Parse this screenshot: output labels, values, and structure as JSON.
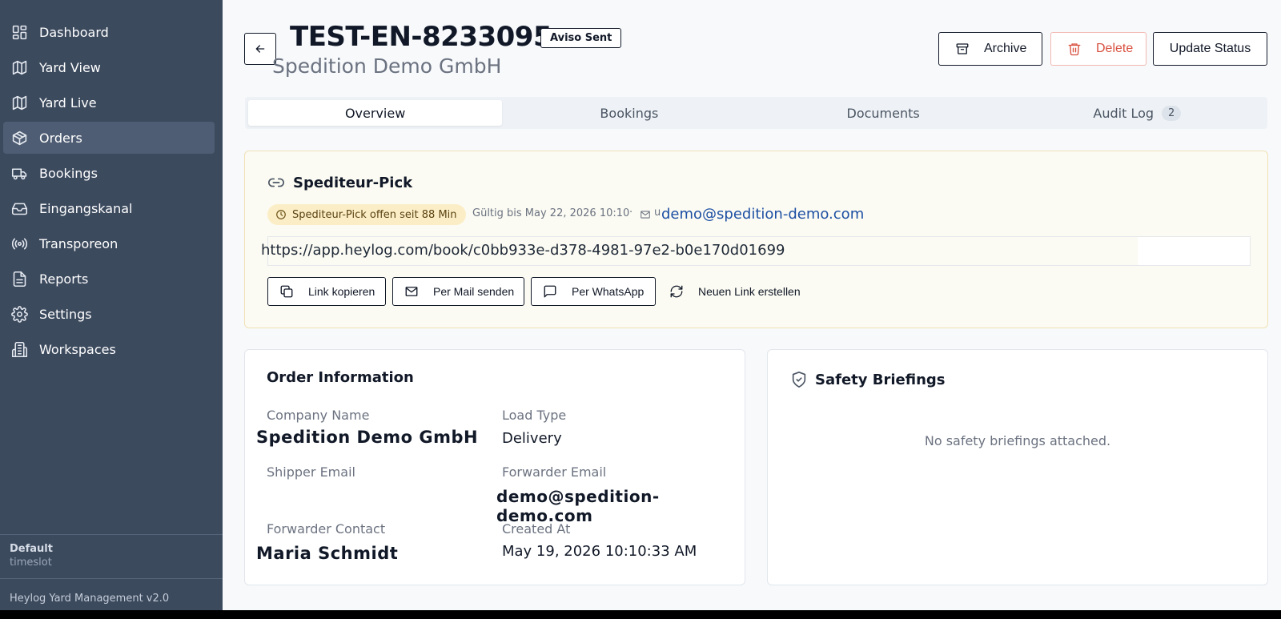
{
  "sidebar": {
    "items": [
      {
        "label": "Dashboard",
        "icon": "dashboard-icon"
      },
      {
        "label": "Yard View",
        "icon": "map-icon"
      },
      {
        "label": "Yard Live",
        "icon": "map-icon"
      },
      {
        "label": "Orders",
        "icon": "package-icon",
        "active": true
      },
      {
        "label": "Bookings",
        "icon": "truck-icon"
      },
      {
        "label": "Eingangskanal",
        "icon": "inbox-icon"
      },
      {
        "label": "Transporeon",
        "icon": "radio-icon"
      },
      {
        "label": "Reports",
        "icon": "file-icon"
      },
      {
        "label": "Settings",
        "icon": "gear-icon"
      },
      {
        "label": "Workspaces",
        "icon": "building-icon"
      }
    ],
    "workspace_name": "Default",
    "workspace_type": "timeslot",
    "version": "Heylog Yard Management v2.0"
  },
  "header": {
    "order_id": "TEST-EN-8233095",
    "status_badge": "Aviso Sent",
    "company": "Spedition Demo GmbH",
    "archive_label": "Archive",
    "delete_label": "Delete",
    "update_label": "Update Status"
  },
  "tabs": [
    {
      "label": "Overview",
      "active": true
    },
    {
      "label": "Bookings"
    },
    {
      "label": "Documents"
    },
    {
      "label": "Audit Log",
      "count": "2"
    }
  ],
  "pick": {
    "title": "Spediteur-Pick",
    "status_pill": "Spediteur-Pick offen seit 88 Min",
    "valid_until": "Gültig bis May 22, 2026 10:10",
    "separator": "·",
    "mail_prefix": "u",
    "email": "demo@spedition-demo.com",
    "link": "https://app.heylog.com/book/c0bb933e-d378-4981-97e2-b0e170d01699",
    "copy_label": "Link kopieren",
    "mail_label": "Per Mail senden",
    "whatsapp_label": "Per WhatsApp",
    "new_link_label": "Neuen Link erstellen"
  },
  "order_info": {
    "title": "Order Information",
    "company_label": "Company Name",
    "company_value": "Spedition Demo GmbH",
    "load_type_label": "Load Type",
    "load_type_value": "Delivery",
    "shipper_email_label": "Shipper Email",
    "forwarder_email_label": "Forwarder Email",
    "forwarder_email_value": "demo@spedition-demo.com",
    "forwarder_contact_label": "Forwarder Contact",
    "forwarder_contact_value": "Maria Schmidt",
    "created_at_label": "Created At",
    "created_at_value": "May 19, 2026 10:10:33 AM"
  },
  "safety": {
    "title": "Safety Briefings",
    "empty": "No safety briefings attached."
  },
  "colors": {
    "sidebar_bg": "#3c4a5e",
    "accent_link": "#1d4fa3",
    "danger": "#d8503f",
    "pick_bg": "#fbfbf3",
    "pill_bg": "#fbeec7"
  }
}
